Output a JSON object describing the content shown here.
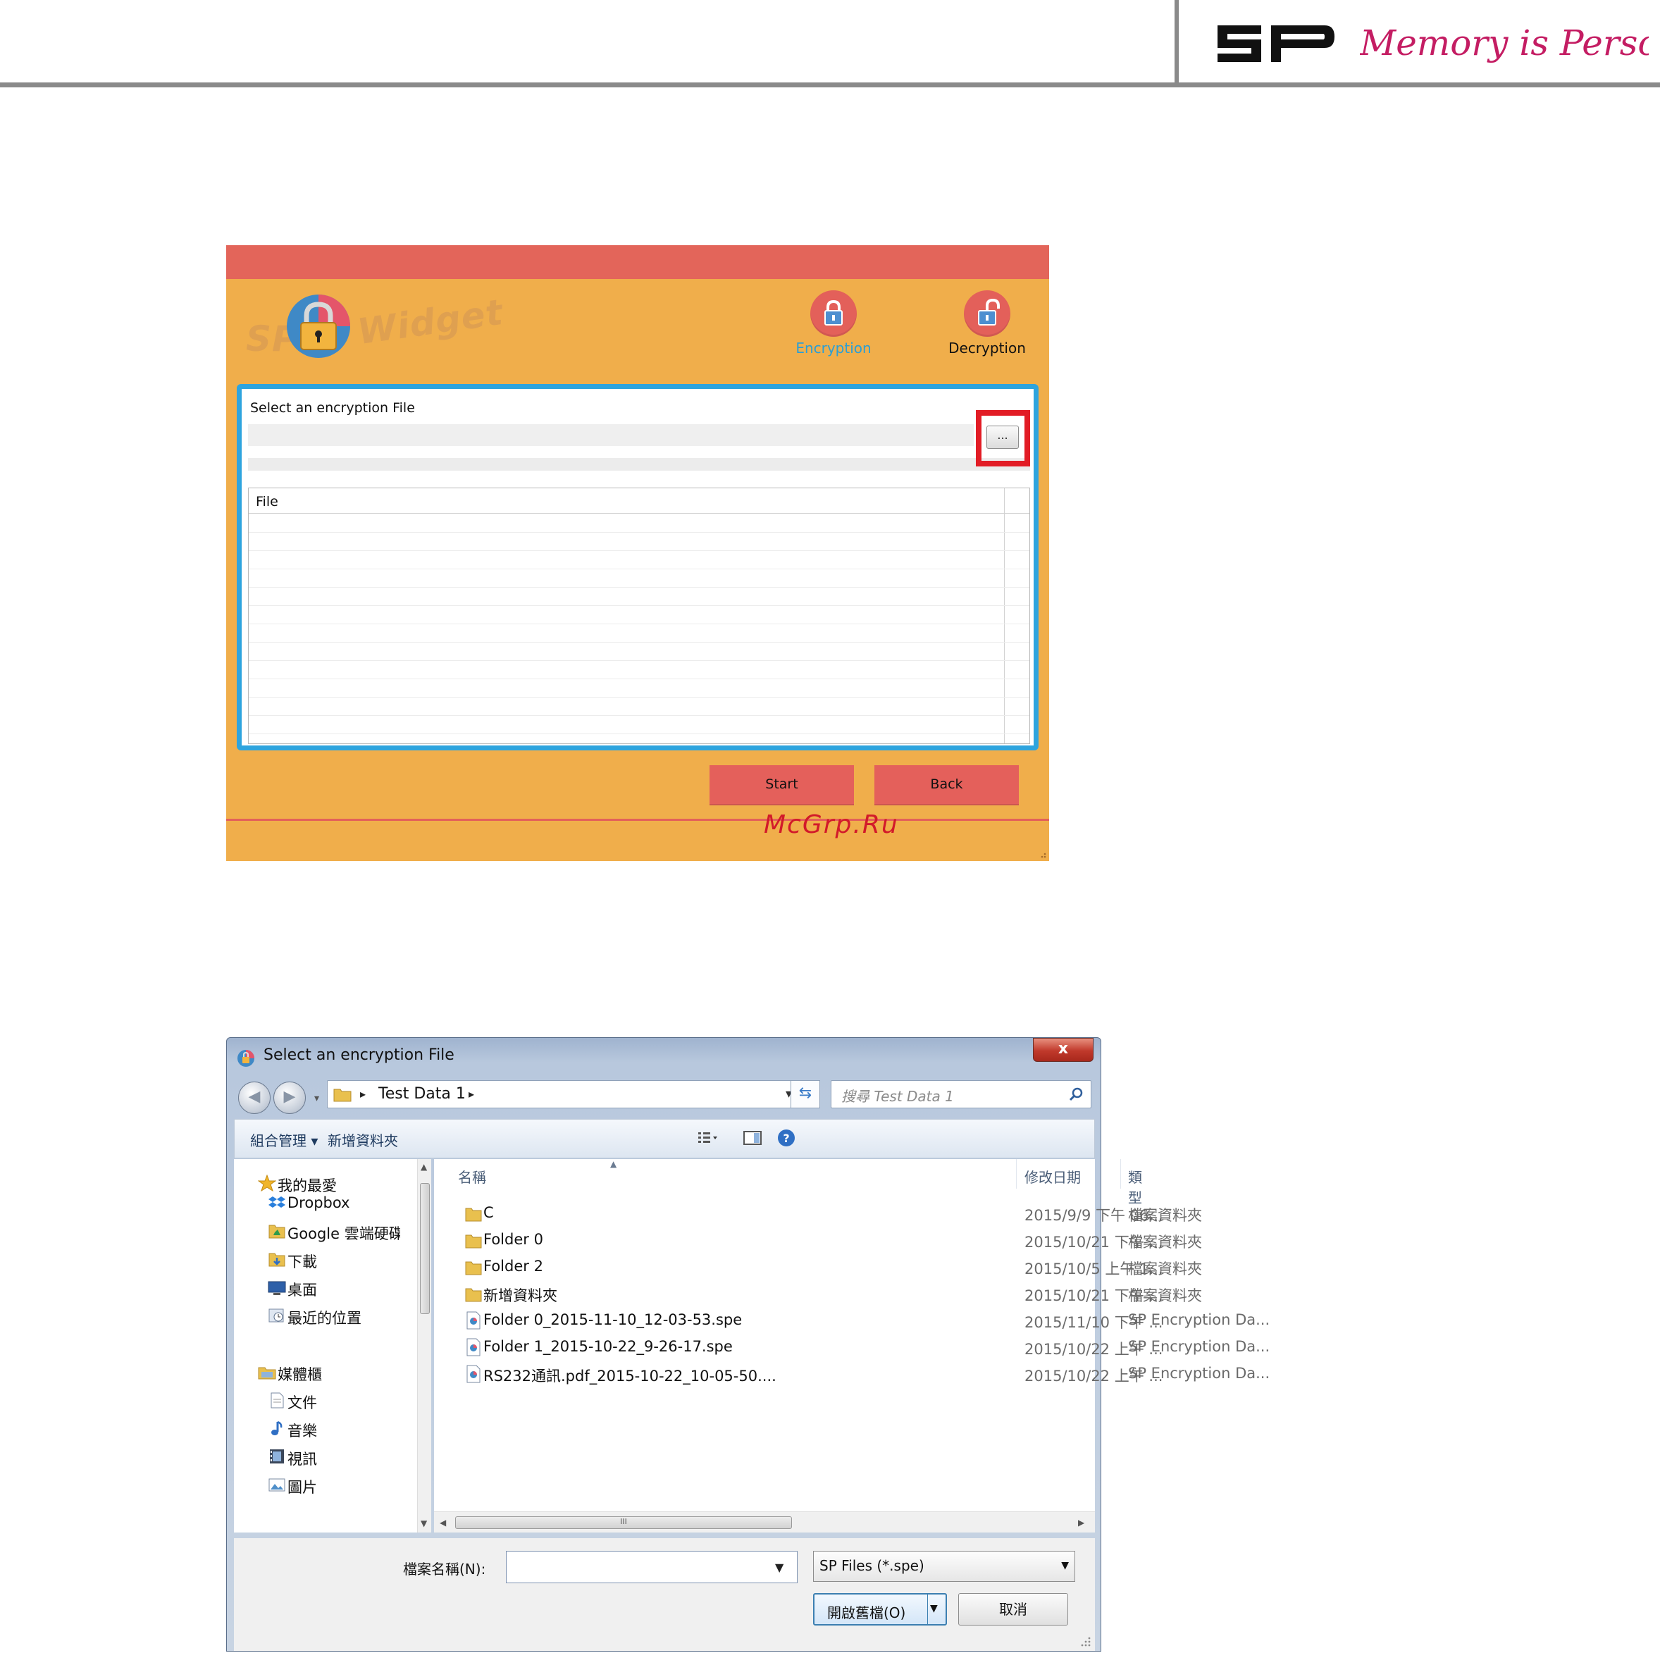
{
  "page_header": {
    "brand": "SP",
    "tagline": "Memory is Personal"
  },
  "widget": {
    "logo_text": "SP Widget",
    "modes": [
      {
        "label": "Encryption",
        "active": true
      },
      {
        "label": "Decryption",
        "active": false
      }
    ],
    "panel_label": "Select an encryption File",
    "path_value": "",
    "browse_label": "...",
    "table_header": "File",
    "buttons": {
      "start": "Start",
      "back": "Back"
    },
    "colors": {
      "accent": "#2ea4de",
      "bar": "#e3655a",
      "background": "#f0ae4b",
      "highlight": "#e21c25"
    }
  },
  "watermark": "McGrp.Ru",
  "dialog": {
    "title": "Select an encryption File",
    "close_label": "x",
    "address_crumb": "Test Data 1",
    "search_placeholder": "搜尋 Test Data 1",
    "toolbar": {
      "organize": "組合管理 ▾",
      "new_folder": "新增資料夾"
    },
    "nav": {
      "favorites_header": "我的最愛",
      "favorites": [
        "Dropbox",
        "Google 雲端硬碟",
        "下載",
        "桌面",
        "最近的位置"
      ],
      "libraries_header": "媒體櫃",
      "libraries": [
        "文件",
        "音樂",
        "視訊",
        "圖片"
      ]
    },
    "columns": {
      "name": "名稱",
      "date": "修改日期",
      "type": "類型"
    },
    "files": [
      {
        "name": "C",
        "date": "2015/9/9 下午 06...",
        "type": "檔案資料夾",
        "kind": "folder"
      },
      {
        "name": "Folder 0",
        "date": "2015/10/21 下午 ...",
        "type": "檔案資料夾",
        "kind": "folder"
      },
      {
        "name": "Folder 2",
        "date": "2015/10/5 上午 1...",
        "type": "檔案資料夾",
        "kind": "folder"
      },
      {
        "name": "新增資料夾",
        "date": "2015/10/21 下午 ...",
        "type": "檔案資料夾",
        "kind": "folder"
      },
      {
        "name": "Folder 0_2015-11-10_12-03-53.spe",
        "date": "2015/11/10 下午 ...",
        "type": "SP Encryption Da...",
        "kind": "file"
      },
      {
        "name": "Folder 1_2015-10-22_9-26-17.spe",
        "date": "2015/10/22 上午 ...",
        "type": "SP Encryption Da...",
        "kind": "file"
      },
      {
        "name": "RS232通訊.pdf_2015-10-22_10-05-50....",
        "date": "2015/10/22 上午 ...",
        "type": "SP Encryption Da...",
        "kind": "file"
      }
    ],
    "hscroll_label": "III",
    "filename_label": "檔案名稱(N):",
    "filename_value": "",
    "filetype_value": "SP Files (*.spe)",
    "open_label": "開啟舊檔(O)",
    "cancel_label": "取消"
  }
}
